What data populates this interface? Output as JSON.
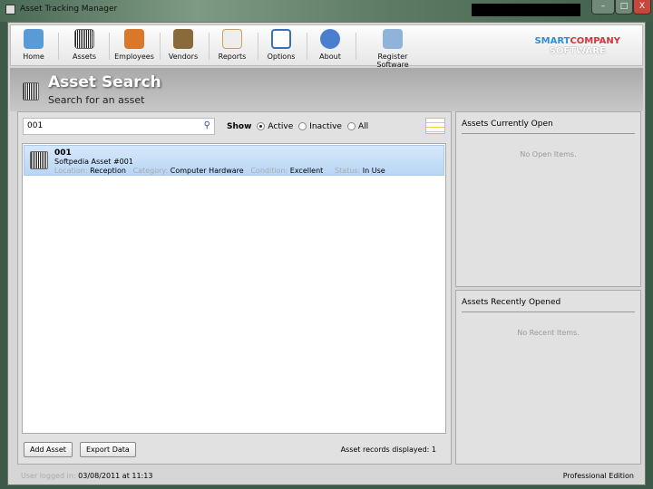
{
  "window": {
    "title": "Asset Tracking Manager",
    "minimize": "–",
    "maximize": "□",
    "close": "X"
  },
  "toolbar": {
    "items": [
      {
        "label": "Home",
        "icon": "home-icon"
      },
      {
        "label": "Assets",
        "icon": "barcode-icon"
      },
      {
        "label": "Employees",
        "icon": "employees-icon"
      },
      {
        "label": "Vendors",
        "icon": "vendors-icon"
      },
      {
        "label": "Reports",
        "icon": "reports-icon"
      },
      {
        "label": "Options",
        "icon": "checklist-icon"
      },
      {
        "label": "About",
        "icon": "info-icon"
      },
      {
        "label": "Register Software",
        "icon": "register-icon"
      }
    ],
    "logo": {
      "line1a": "SMART",
      "line1b": "COMPANY",
      "line2": "SOFTWARE"
    }
  },
  "header": {
    "title": "Asset Search",
    "subtitle": "Search for an asset"
  },
  "search": {
    "value": "001",
    "show_label": "Show",
    "options": [
      "Active",
      "Inactive",
      "All"
    ],
    "selected": "Active"
  },
  "results": [
    {
      "code": "001",
      "name": "Softpedia Asset #001",
      "location_label": "Location:",
      "location": "Reception",
      "category_label": "Category:",
      "category": "Computer Hardware",
      "condition_label": "Condition:",
      "condition": "Excellent",
      "status_label": "Status:",
      "status": "In Use"
    }
  ],
  "buttons": {
    "add": "Add Asset",
    "export": "Export Data"
  },
  "count_text": "Asset records displayed: 1",
  "right": {
    "open_title": "Assets Currently Open",
    "open_empty": "No Open Items.",
    "recent_title": "Assets Recently Opened",
    "recent_empty": "No Recent Items."
  },
  "status": {
    "user_label": "User logged in:",
    "user_value": "03/08/2011 at 11:13",
    "edition": "Professional Edition"
  },
  "colors": {
    "accent": "#2e8fd6",
    "logo_red": "#d9343a",
    "selection": "#c5defa"
  }
}
